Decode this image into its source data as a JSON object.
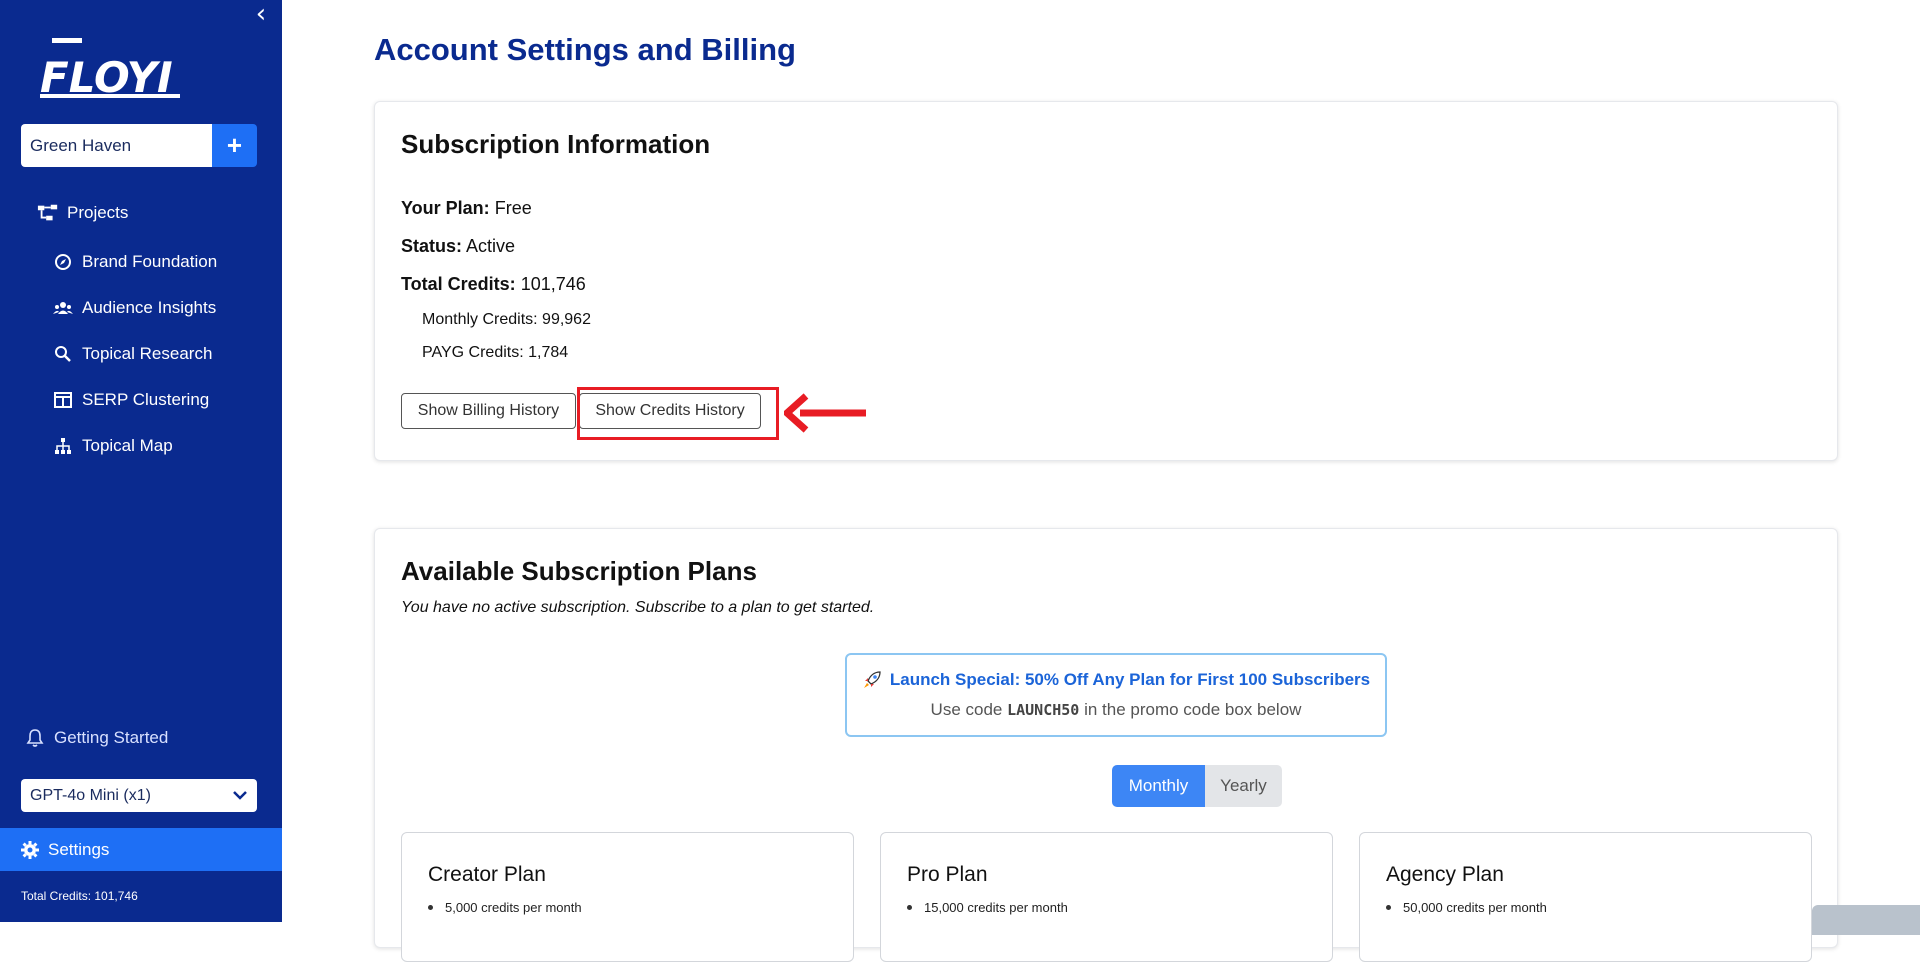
{
  "sidebar": {
    "logo_text": "FLOYI",
    "project_name": "Green Haven",
    "add_label": "+",
    "nav": [
      {
        "label": "Projects",
        "icon": "projects-icon"
      },
      {
        "label": "Brand Foundation",
        "icon": "compass-icon"
      },
      {
        "label": "Audience Insights",
        "icon": "users-icon"
      },
      {
        "label": "Topical Research",
        "icon": "search-icon"
      },
      {
        "label": "SERP Clustering",
        "icon": "table-icon"
      },
      {
        "label": "Topical Map",
        "icon": "sitemap-icon"
      }
    ],
    "getting_started": "Getting Started",
    "model": "GPT-4o Mini (x1)",
    "settings": "Settings",
    "total_credits": "Total Credits: 101,746"
  },
  "page": {
    "title": "Account Settings and Billing"
  },
  "subscription": {
    "title": "Subscription Information",
    "plan_label": "Your Plan:",
    "plan_value": "Free",
    "status_label": "Status:",
    "status_value": "Active",
    "total_label": "Total Credits:",
    "total_value": "101,746",
    "monthly_credits": "Monthly Credits: 99,962",
    "payg_credits": "PAYG Credits: 1,784",
    "billing_history_btn": "Show Billing History",
    "credits_history_btn": "Show Credits History"
  },
  "plans": {
    "title": "Available Subscription Plans",
    "subtitle": "You have no active subscription. Subscribe to a plan to get started.",
    "promo_title": "Launch Special: 50% Off Any Plan for First 100 Subscribers",
    "promo_text_before": "Use code ",
    "promo_code": "LAUNCH50",
    "promo_text_after": " in the promo code box below",
    "toggle": {
      "monthly": "Monthly",
      "yearly": "Yearly",
      "selected": "Monthly"
    },
    "items": [
      {
        "name": "Creator Plan",
        "feature": "5,000 credits per month"
      },
      {
        "name": "Pro Plan",
        "feature": "15,000 credits per month"
      },
      {
        "name": "Agency Plan",
        "feature": "50,000 credits per month"
      }
    ]
  },
  "colors": {
    "sidebar_bg": "#0a2a8f",
    "accent": "#1e6ff5",
    "title": "#0a2a8f",
    "highlight": "#e81c24"
  }
}
